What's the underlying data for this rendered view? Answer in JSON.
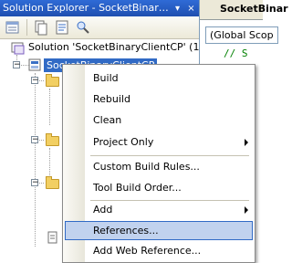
{
  "panel": {
    "title": "Solution Explorer - SocketBinar…",
    "pin_glyph": "▾",
    "close_glyph": "×"
  },
  "tree": {
    "solution_label": "Solution 'SocketBinaryClientCP' (1 proje",
    "project_label": "SocketBinaryClientCP"
  },
  "editor": {
    "tab_title": "SocketBinar",
    "scope_combo": "(Global Scop",
    "code_text": "// S"
  },
  "menu": {
    "items": [
      {
        "label": "Build"
      },
      {
        "label": "Rebuild"
      },
      {
        "label": "Clean"
      },
      {
        "label": "Project Only"
      },
      {
        "label": "Custom Build Rules..."
      },
      {
        "label": "Tool Build Order..."
      },
      {
        "label": "Add"
      },
      {
        "label": "References..."
      },
      {
        "label": "Add Web Reference..."
      }
    ]
  },
  "colors": {
    "titlebar": "#1f4fb0",
    "selection": "#316ac5",
    "menu_highlight": "#c1d2ee"
  },
  "icons": [
    "solution-icon",
    "project-icon",
    "folder-icon",
    "pin-icon",
    "close-icon",
    "submenu-arrow-icon"
  ]
}
